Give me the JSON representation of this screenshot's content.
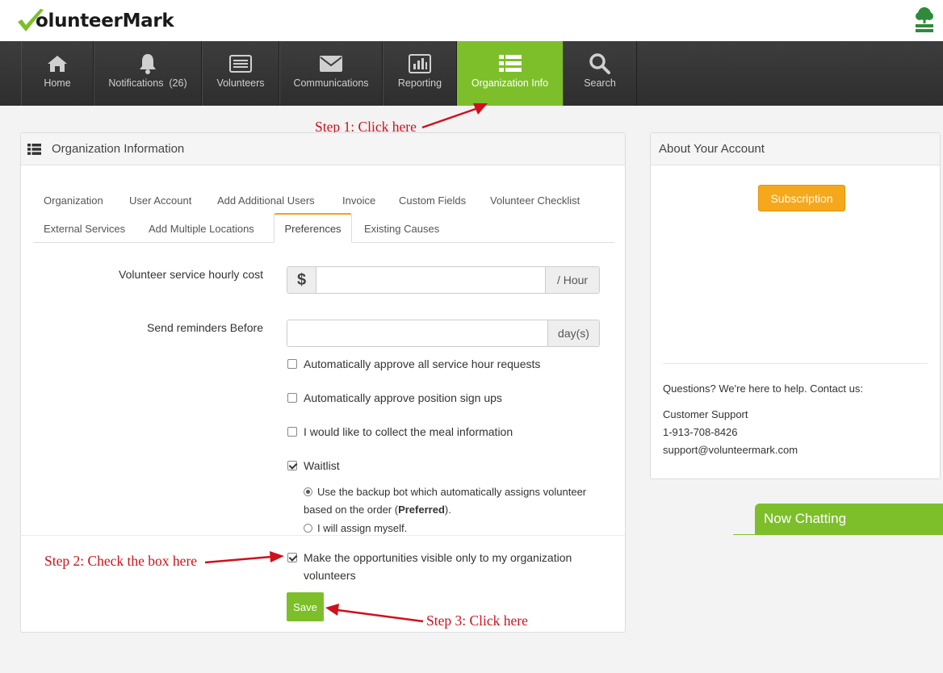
{
  "brand": {
    "logo_text": "olunteerMark",
    "accent": "#7dbf2a",
    "logo_icon": "check-mark-icon",
    "partner_icon": "tree-logo-icon"
  },
  "nav": [
    {
      "label": "Home",
      "icon": "home-icon"
    },
    {
      "label": "Notifications  (26)",
      "icon": "bell-icon"
    },
    {
      "label": "Volunteers",
      "icon": "list-box-icon"
    },
    {
      "label": "Communications",
      "icon": "envelope-icon"
    },
    {
      "label": "Reporting",
      "icon": "bar-chart-icon"
    },
    {
      "label": "Organization Info",
      "icon": "list-icon",
      "active": true
    },
    {
      "label": "Search",
      "icon": "search-icon"
    }
  ],
  "annotations": {
    "step1": "Step 1: Click here",
    "step2": "Step 2: Check the box here",
    "step3": "Step 3: Click here",
    "color": "#d0101a"
  },
  "org_panel": {
    "title": "Organization Information",
    "tabs_row1": [
      "Organization",
      "User Account",
      "Add Additional Users",
      "Invoice",
      "Custom Fields",
      "Volunteer Checklist"
    ],
    "tabs_row2": [
      "External Services",
      "Add Multiple Locations",
      "Preferences",
      "Existing Causes"
    ],
    "active_tab": "Preferences",
    "hourly_cost": {
      "label": "Volunteer service hourly cost",
      "prefix": "$",
      "suffix": "/ Hour",
      "value": ""
    },
    "reminders": {
      "label": "Send reminders Before",
      "suffix": "day(s)",
      "value": ""
    },
    "checks": [
      {
        "label": "Automatically approve all service hour requests",
        "checked": false
      },
      {
        "label": "Automatically approve position sign ups",
        "checked": false
      },
      {
        "label": "I would like to collect the meal information",
        "checked": false
      },
      {
        "label": "Waitlist",
        "checked": true
      }
    ],
    "waitlist_options": {
      "opt1_a": "Use the backup bot which automatically assigns volunteer",
      "opt1_b": "based on the order (",
      "opt1_bold": "Preferred",
      "opt1_end": ").",
      "opt2": "I will assign myself."
    },
    "visibility": {
      "line1": "Make the opportunities visible only to my organization",
      "line2": "volunteers",
      "checked": true
    },
    "save_label": "Save"
  },
  "account_panel": {
    "title": "About Your Account",
    "subscription_label": "Subscription",
    "help_text": "Questions? We're here to help. Contact us:",
    "support_title": "Customer Support",
    "phone": "1-913-708-8426",
    "email": "support@volunteermark.com"
  },
  "chat": {
    "label": "Now Chatting"
  }
}
